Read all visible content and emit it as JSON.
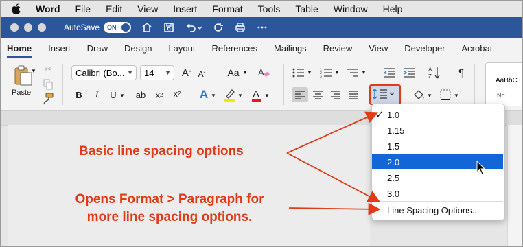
{
  "menubar": {
    "app_name": "Word",
    "items": [
      "File",
      "Edit",
      "View",
      "Insert",
      "Format",
      "Tools",
      "Table",
      "Window",
      "Help"
    ]
  },
  "titlebar": {
    "autosave_label": "AutoSave",
    "autosave_state": "ON"
  },
  "ribbon_tabs": [
    "Home",
    "Insert",
    "Draw",
    "Design",
    "Layout",
    "References",
    "Mailings",
    "Review",
    "View",
    "Developer",
    "Acrobat"
  ],
  "ribbon": {
    "paste_label": "Paste",
    "font_name": "Calibri (Bo...",
    "font_size": "14",
    "style_preview": "AaBbC",
    "style_name": "No"
  },
  "line_spacing_menu": {
    "items": [
      {
        "label": "1.0",
        "checked": true,
        "highlighted": false
      },
      {
        "label": "1.15",
        "checked": false,
        "highlighted": false
      },
      {
        "label": "1.5",
        "checked": false,
        "highlighted": false
      },
      {
        "label": "2.0",
        "checked": false,
        "highlighted": true
      },
      {
        "label": "2.5",
        "checked": false,
        "highlighted": false
      },
      {
        "label": "3.0",
        "checked": false,
        "highlighted": false
      }
    ],
    "options_label": "Line Spacing Options..."
  },
  "annotations": {
    "basic": "Basic line spacing options",
    "opens_line1": "Opens Format > Paragraph for",
    "opens_line2": "more line spacing options."
  },
  "colors": {
    "title_bar": "#2b579a",
    "annotation_red": "#e23a16",
    "highlight_blue": "#1366d6"
  }
}
